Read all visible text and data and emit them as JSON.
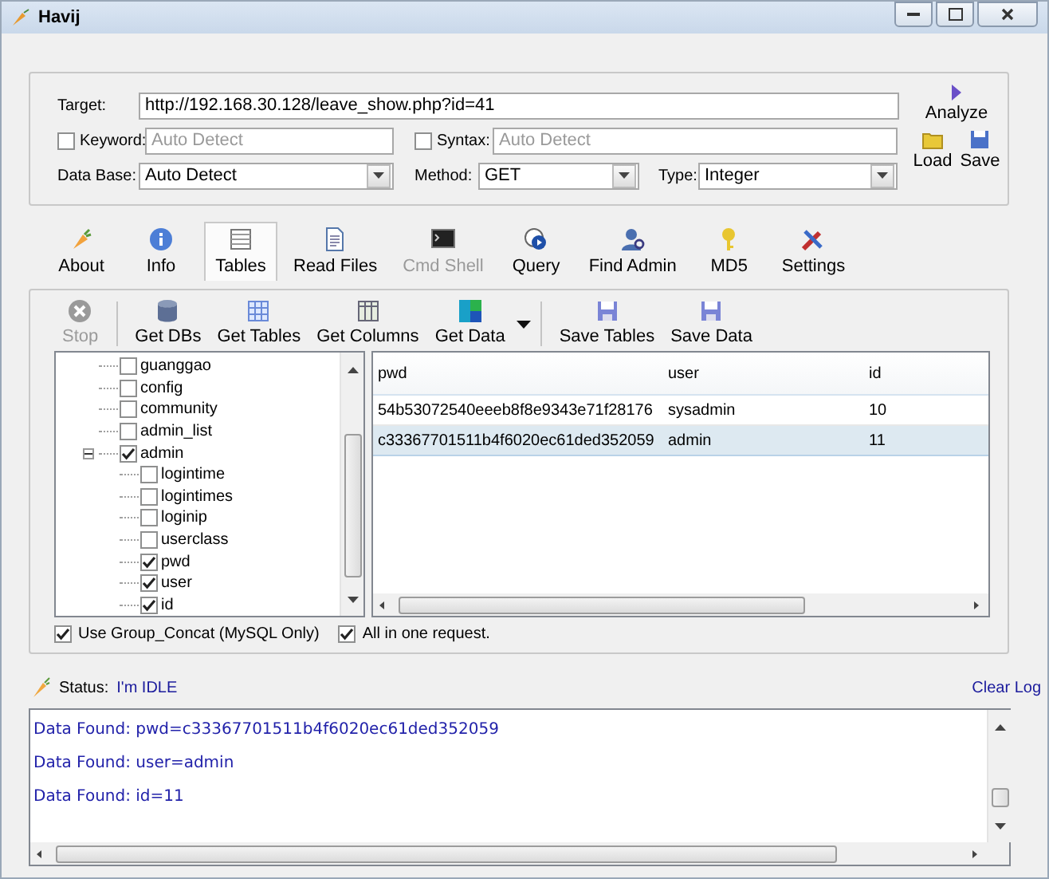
{
  "window": {
    "title": "Havij"
  },
  "target": {
    "label": "Target:",
    "value": "http://192.168.30.128/leave_show.php?id=41"
  },
  "keyword": {
    "label": "Keyword:",
    "checked": false,
    "placeholder": "Auto Detect"
  },
  "syntax": {
    "label": "Syntax:",
    "checked": false,
    "placeholder": "Auto Detect"
  },
  "database": {
    "label": "Data Base:",
    "value": "Auto Detect"
  },
  "method": {
    "label": "Method:",
    "value": "GET"
  },
  "type": {
    "label": "Type:",
    "value": "Integer"
  },
  "side_buttons": [
    {
      "label": "Analyze"
    },
    {
      "label": "Load"
    },
    {
      "label": "Save"
    }
  ],
  "tabs": [
    {
      "label": "About",
      "selected": false,
      "disabled": false
    },
    {
      "label": "Info",
      "selected": false,
      "disabled": false
    },
    {
      "label": "Tables",
      "selected": true,
      "disabled": false
    },
    {
      "label": "Read Files",
      "selected": false,
      "disabled": false
    },
    {
      "label": "Cmd Shell",
      "selected": false,
      "disabled": true
    },
    {
      "label": "Query",
      "selected": false,
      "disabled": false
    },
    {
      "label": "Find Admin",
      "selected": false,
      "disabled": false
    },
    {
      "label": "MD5",
      "selected": false,
      "disabled": false
    },
    {
      "label": "Settings",
      "selected": false,
      "disabled": false
    }
  ],
  "toolbar": [
    [
      {
        "label": "Stop",
        "disabled": true,
        "menu": false
      }
    ],
    [
      {
        "label": "Get DBs",
        "disabled": false,
        "menu": false
      },
      {
        "label": "Get Tables",
        "disabled": false,
        "menu": false
      },
      {
        "label": "Get Columns",
        "disabled": false,
        "menu": false
      },
      {
        "label": "Get Data",
        "disabled": false,
        "menu": true
      }
    ],
    [
      {
        "label": "Save Tables",
        "disabled": false,
        "menu": false
      },
      {
        "label": "Save Data",
        "disabled": false,
        "menu": false
      }
    ]
  ],
  "tree": [
    {
      "label": "guanggao",
      "checked": false
    },
    {
      "label": "config",
      "checked": false
    },
    {
      "label": "community",
      "checked": false
    },
    {
      "label": "admin_list",
      "checked": false
    },
    {
      "label": "admin",
      "checked": true,
      "expanded": true,
      "children": [
        {
          "label": "logintime",
          "checked": false
        },
        {
          "label": "logintimes",
          "checked": false
        },
        {
          "label": "loginip",
          "checked": false
        },
        {
          "label": "userclass",
          "checked": false
        },
        {
          "label": "pwd",
          "checked": true
        },
        {
          "label": "user",
          "checked": true
        },
        {
          "label": "id",
          "checked": true
        }
      ]
    }
  ],
  "options": [
    {
      "label": "Use Group_Concat (MySQL Only)",
      "checked": true
    },
    {
      "label": "All in one request.",
      "checked": true
    }
  ],
  "grid": {
    "columns": [
      "pwd",
      "user",
      "id"
    ],
    "rows": [
      {
        "cells": [
          "54b53072540eeeb8f8e9343e71f28176",
          "sysadmin",
          "10"
        ],
        "selected": false
      },
      {
        "cells": [
          "c33367701511b4f6020ec61ded352059",
          "admin",
          "11"
        ],
        "selected": true
      }
    ]
  },
  "status": {
    "label": "Status:",
    "value": "I'm IDLE",
    "action": "Clear Log"
  },
  "log": [
    "Data Found: pwd=c33367701511b4f6020ec61ded352059",
    "Data Found: user=admin",
    "Data Found: id=11"
  ]
}
